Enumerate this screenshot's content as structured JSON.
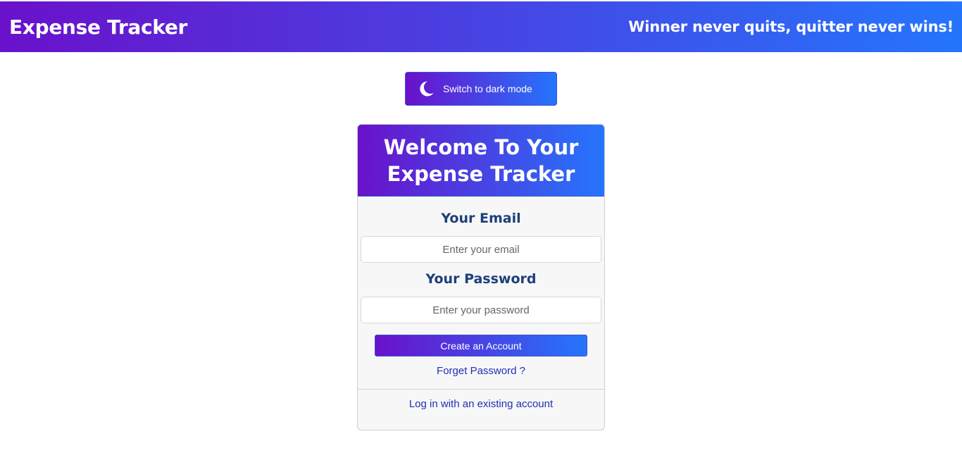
{
  "navbar": {
    "brand": "Expense Tracker",
    "motto": "Winner never quits, quitter never wins!"
  },
  "theme_toggle": {
    "icon": "moon-icon",
    "label": "Switch to dark mode"
  },
  "card": {
    "title": "Welcome To Your Expense Tracker",
    "email_label": "Your Email",
    "email_placeholder": "Enter your email",
    "password_label": "Your Password",
    "password_placeholder": "Enter your password",
    "create_button": "Create an Account",
    "forget_link": "Forget Password ?",
    "login_link": "Log in with an existing account"
  },
  "colors": {
    "gradient_start": "#6a11cb",
    "gradient_end": "#2575fc",
    "label_color": "#1d3f7a",
    "link_color": "#1f2fb5"
  }
}
